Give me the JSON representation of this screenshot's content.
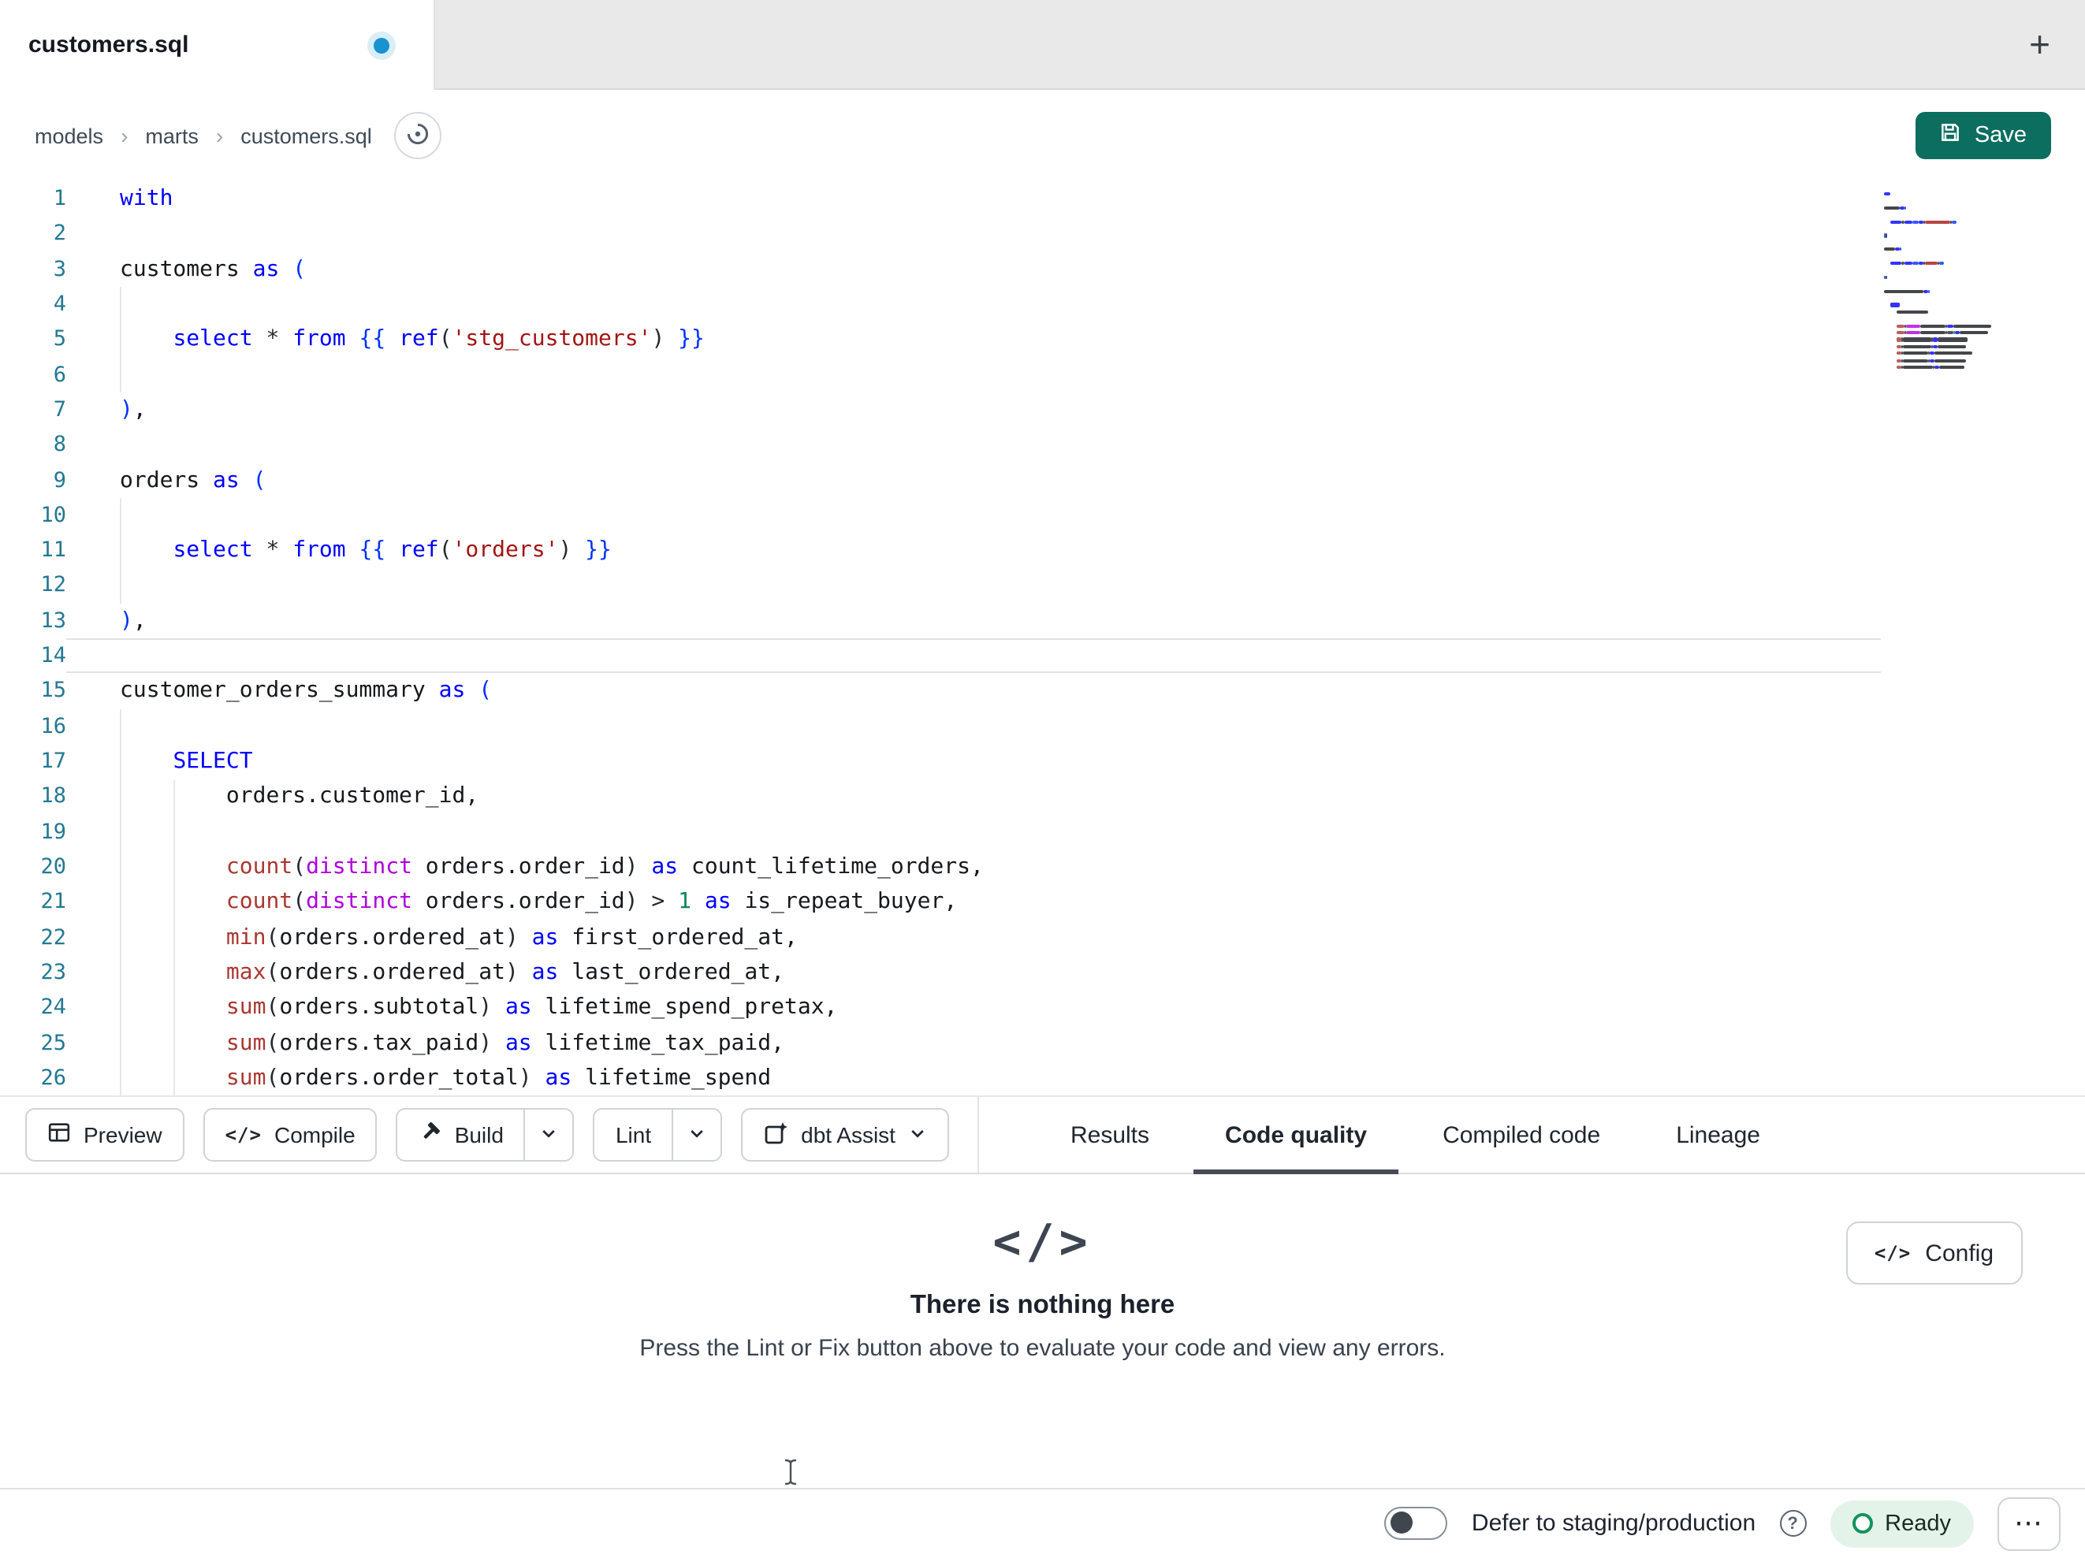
{
  "window": {
    "tab_title": "customers.sql",
    "new_tab_label": "+"
  },
  "breadcrumb": {
    "items": [
      "models",
      "marts",
      "customers.sql"
    ],
    "separator": "›"
  },
  "actions": {
    "save_label": "Save"
  },
  "editor": {
    "current_line": 14,
    "lines": [
      [
        [
          "with",
          "kw"
        ]
      ],
      [],
      [
        [
          "customers ",
          "id"
        ],
        [
          "as ",
          "kw"
        ],
        [
          "(",
          "br"
        ]
      ],
      [],
      [
        [
          "    ",
          "ws"
        ],
        [
          "select ",
          "kw"
        ],
        [
          "* ",
          "op"
        ],
        [
          "from ",
          "kw"
        ],
        [
          "{{ ",
          "br"
        ],
        [
          "ref",
          "kw"
        ],
        [
          "(",
          "p"
        ],
        [
          "'stg_customers'",
          "str"
        ],
        [
          ")",
          "p"
        ],
        [
          " }}",
          "br"
        ]
      ],
      [],
      [
        [
          ")",
          "br"
        ],
        [
          ",",
          "id"
        ]
      ],
      [],
      [
        [
          "orders ",
          "id"
        ],
        [
          "as ",
          "kw"
        ],
        [
          "(",
          "br"
        ]
      ],
      [],
      [
        [
          "    ",
          "ws"
        ],
        [
          "select ",
          "kw"
        ],
        [
          "* ",
          "op"
        ],
        [
          "from ",
          "kw"
        ],
        [
          "{{ ",
          "br"
        ],
        [
          "ref",
          "kw"
        ],
        [
          "(",
          "p"
        ],
        [
          "'orders'",
          "str"
        ],
        [
          ")",
          "p"
        ],
        [
          " }}",
          "br"
        ]
      ],
      [],
      [
        [
          ")",
          "br"
        ],
        [
          ",",
          "id"
        ]
      ],
      [],
      [
        [
          "customer_orders_summary ",
          "id"
        ],
        [
          "as ",
          "kw"
        ],
        [
          "(",
          "br"
        ]
      ],
      [],
      [
        [
          "    ",
          "ws"
        ],
        [
          "SELECT",
          "kw"
        ]
      ],
      [
        [
          "        ",
          "ws"
        ],
        [
          "orders.customer_id,",
          "id"
        ]
      ],
      [],
      [
        [
          "        ",
          "ws"
        ],
        [
          "count",
          "fn"
        ],
        [
          "(",
          "p"
        ],
        [
          "distinct",
          "ctrl"
        ],
        [
          " orders.order_id",
          "id"
        ],
        [
          ")",
          "p"
        ],
        [
          " as",
          "kw"
        ],
        [
          " count_lifetime_orders,",
          "id"
        ]
      ],
      [
        [
          "        ",
          "ws"
        ],
        [
          "count",
          "fn"
        ],
        [
          "(",
          "p"
        ],
        [
          "distinct",
          "ctrl"
        ],
        [
          " orders.order_id",
          "id"
        ],
        [
          ")",
          "p"
        ],
        [
          " > ",
          "op"
        ],
        [
          "1",
          "num"
        ],
        [
          " as",
          "kw"
        ],
        [
          " is_repeat_buyer,",
          "id"
        ]
      ],
      [
        [
          "        ",
          "ws"
        ],
        [
          "min",
          "fn"
        ],
        [
          "(",
          "p"
        ],
        [
          "orders.ordered_at",
          "id"
        ],
        [
          ")",
          "p"
        ],
        [
          " as",
          "kw"
        ],
        [
          " first_ordered_at,",
          "id"
        ]
      ],
      [
        [
          "        ",
          "ws"
        ],
        [
          "max",
          "fn"
        ],
        [
          "(",
          "p"
        ],
        [
          "orders.ordered_at",
          "id"
        ],
        [
          ")",
          "p"
        ],
        [
          " as",
          "kw"
        ],
        [
          " last_ordered_at,",
          "id"
        ]
      ],
      [
        [
          "        ",
          "ws"
        ],
        [
          "sum",
          "fn"
        ],
        [
          "(",
          "p"
        ],
        [
          "orders.subtotal",
          "id"
        ],
        [
          ")",
          "p"
        ],
        [
          " as",
          "kw"
        ],
        [
          " lifetime_spend_pretax,",
          "id"
        ]
      ],
      [
        [
          "        ",
          "ws"
        ],
        [
          "sum",
          "fn"
        ],
        [
          "(",
          "p"
        ],
        [
          "orders.tax_paid",
          "id"
        ],
        [
          ")",
          "p"
        ],
        [
          " as",
          "kw"
        ],
        [
          " lifetime_tax_paid,",
          "id"
        ]
      ],
      [
        [
          "        ",
          "ws"
        ],
        [
          "sum",
          "fn"
        ],
        [
          "(",
          "p"
        ],
        [
          "orders.order_total",
          "id"
        ],
        [
          ")",
          "p"
        ],
        [
          " as",
          "kw"
        ],
        [
          " lifetime_spend",
          "id"
        ]
      ]
    ]
  },
  "toolbar": {
    "preview_label": "Preview",
    "compile_label": "Compile",
    "build_label": "Build",
    "lint_label": "Lint",
    "assist_label": "dbt Assist",
    "compile_glyph": "</>"
  },
  "result_tabs": [
    {
      "label": "Results",
      "active": false
    },
    {
      "label": "Code quality",
      "active": true
    },
    {
      "label": "Compiled code",
      "active": false
    },
    {
      "label": "Lineage",
      "active": false
    }
  ],
  "empty_state": {
    "glyph": "</>",
    "title": "There is nothing here",
    "message": "Press the Lint or Fix button above to evaluate your code and view any errors.",
    "config_label": "Config",
    "config_glyph": "</>"
  },
  "status_bar": {
    "defer_label": "Defer to staging/production",
    "defer_on": false,
    "help_glyph": "?",
    "ready_label": "Ready",
    "more_label": "⋯"
  },
  "palette": {
    "kw": "#0000FF",
    "id": "#16181D",
    "str": "#A31515",
    "fn": "#AA3731",
    "ctrl": "#AF00DB",
    "num": "#098658",
    "br": "#0431FA",
    "p": "#24292F",
    "op": "#24292F",
    "accent_green": "#0B6E5F",
    "line_number": "#237893",
    "dirty_dot": "#1793CF"
  }
}
